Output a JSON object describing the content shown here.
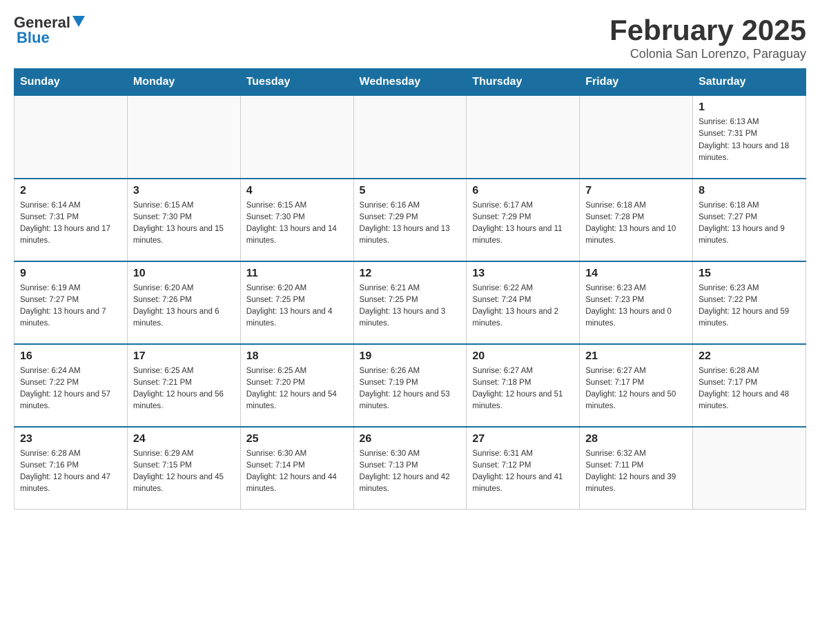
{
  "header": {
    "logo": {
      "general": "General",
      "blue": "Blue"
    },
    "title": "February 2025",
    "subtitle": "Colonia San Lorenzo, Paraguay"
  },
  "days_of_week": [
    "Sunday",
    "Monday",
    "Tuesday",
    "Wednesday",
    "Thursday",
    "Friday",
    "Saturday"
  ],
  "weeks": [
    [
      {
        "day": "",
        "info": ""
      },
      {
        "day": "",
        "info": ""
      },
      {
        "day": "",
        "info": ""
      },
      {
        "day": "",
        "info": ""
      },
      {
        "day": "",
        "info": ""
      },
      {
        "day": "",
        "info": ""
      },
      {
        "day": "1",
        "info": "Sunrise: 6:13 AM\nSunset: 7:31 PM\nDaylight: 13 hours and 18 minutes."
      }
    ],
    [
      {
        "day": "2",
        "info": "Sunrise: 6:14 AM\nSunset: 7:31 PM\nDaylight: 13 hours and 17 minutes."
      },
      {
        "day": "3",
        "info": "Sunrise: 6:15 AM\nSunset: 7:30 PM\nDaylight: 13 hours and 15 minutes."
      },
      {
        "day": "4",
        "info": "Sunrise: 6:15 AM\nSunset: 7:30 PM\nDaylight: 13 hours and 14 minutes."
      },
      {
        "day": "5",
        "info": "Sunrise: 6:16 AM\nSunset: 7:29 PM\nDaylight: 13 hours and 13 minutes."
      },
      {
        "day": "6",
        "info": "Sunrise: 6:17 AM\nSunset: 7:29 PM\nDaylight: 13 hours and 11 minutes."
      },
      {
        "day": "7",
        "info": "Sunrise: 6:18 AM\nSunset: 7:28 PM\nDaylight: 13 hours and 10 minutes."
      },
      {
        "day": "8",
        "info": "Sunrise: 6:18 AM\nSunset: 7:27 PM\nDaylight: 13 hours and 9 minutes."
      }
    ],
    [
      {
        "day": "9",
        "info": "Sunrise: 6:19 AM\nSunset: 7:27 PM\nDaylight: 13 hours and 7 minutes."
      },
      {
        "day": "10",
        "info": "Sunrise: 6:20 AM\nSunset: 7:26 PM\nDaylight: 13 hours and 6 minutes."
      },
      {
        "day": "11",
        "info": "Sunrise: 6:20 AM\nSunset: 7:25 PM\nDaylight: 13 hours and 4 minutes."
      },
      {
        "day": "12",
        "info": "Sunrise: 6:21 AM\nSunset: 7:25 PM\nDaylight: 13 hours and 3 minutes."
      },
      {
        "day": "13",
        "info": "Sunrise: 6:22 AM\nSunset: 7:24 PM\nDaylight: 13 hours and 2 minutes."
      },
      {
        "day": "14",
        "info": "Sunrise: 6:23 AM\nSunset: 7:23 PM\nDaylight: 13 hours and 0 minutes."
      },
      {
        "day": "15",
        "info": "Sunrise: 6:23 AM\nSunset: 7:22 PM\nDaylight: 12 hours and 59 minutes."
      }
    ],
    [
      {
        "day": "16",
        "info": "Sunrise: 6:24 AM\nSunset: 7:22 PM\nDaylight: 12 hours and 57 minutes."
      },
      {
        "day": "17",
        "info": "Sunrise: 6:25 AM\nSunset: 7:21 PM\nDaylight: 12 hours and 56 minutes."
      },
      {
        "day": "18",
        "info": "Sunrise: 6:25 AM\nSunset: 7:20 PM\nDaylight: 12 hours and 54 minutes."
      },
      {
        "day": "19",
        "info": "Sunrise: 6:26 AM\nSunset: 7:19 PM\nDaylight: 12 hours and 53 minutes."
      },
      {
        "day": "20",
        "info": "Sunrise: 6:27 AM\nSunset: 7:18 PM\nDaylight: 12 hours and 51 minutes."
      },
      {
        "day": "21",
        "info": "Sunrise: 6:27 AM\nSunset: 7:17 PM\nDaylight: 12 hours and 50 minutes."
      },
      {
        "day": "22",
        "info": "Sunrise: 6:28 AM\nSunset: 7:17 PM\nDaylight: 12 hours and 48 minutes."
      }
    ],
    [
      {
        "day": "23",
        "info": "Sunrise: 6:28 AM\nSunset: 7:16 PM\nDaylight: 12 hours and 47 minutes."
      },
      {
        "day": "24",
        "info": "Sunrise: 6:29 AM\nSunset: 7:15 PM\nDaylight: 12 hours and 45 minutes."
      },
      {
        "day": "25",
        "info": "Sunrise: 6:30 AM\nSunset: 7:14 PM\nDaylight: 12 hours and 44 minutes."
      },
      {
        "day": "26",
        "info": "Sunrise: 6:30 AM\nSunset: 7:13 PM\nDaylight: 12 hours and 42 minutes."
      },
      {
        "day": "27",
        "info": "Sunrise: 6:31 AM\nSunset: 7:12 PM\nDaylight: 12 hours and 41 minutes."
      },
      {
        "day": "28",
        "info": "Sunrise: 6:32 AM\nSunset: 7:11 PM\nDaylight: 12 hours and 39 minutes."
      },
      {
        "day": "",
        "info": ""
      }
    ]
  ]
}
